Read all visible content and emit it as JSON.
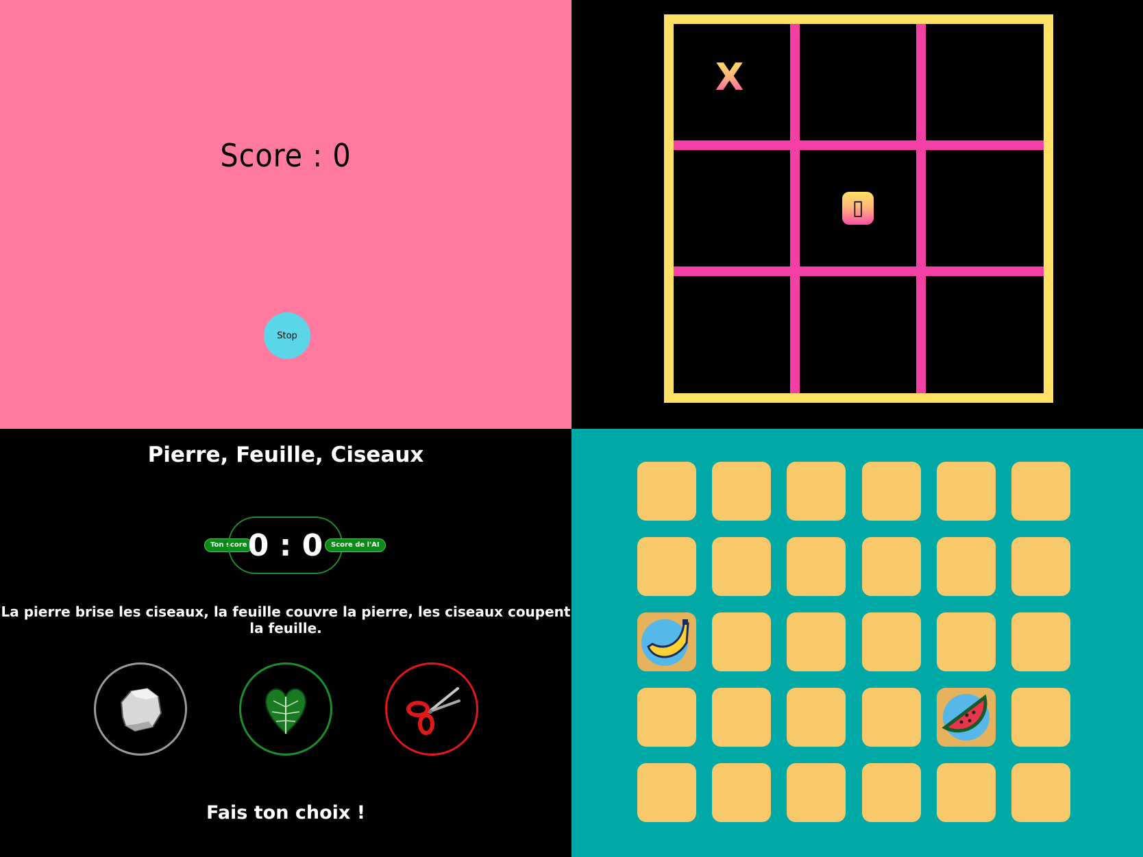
{
  "score_panel": {
    "score_text": "Score : 0",
    "stop_label": "Stop",
    "background": "#ff7a9e",
    "button_color": "#5bd5e8"
  },
  "tic_tac_toe": {
    "board": [
      "X",
      "",
      "",
      "",
      "O",
      "",
      "",
      "",
      ""
    ],
    "frame_color": "#ffe066",
    "grid_color": "#f43fa5"
  },
  "rps": {
    "title": "Pierre, Feuille, Ciseaux",
    "your_score_label": "Ton score",
    "ai_score_label": "Score de l'AI",
    "score_display": "0 : 0",
    "rules": "La pierre brise les ciseaux, la feuille couvre la pierre, les ciseaux coupent la feuille.",
    "prompt": "Fais ton choix !",
    "choices": [
      {
        "name": "rock",
        "icon": "rock-icon",
        "color": "#9a9a9a"
      },
      {
        "name": "paper",
        "icon": "leaf-icon",
        "color": "#1a8f2a"
      },
      {
        "name": "scissors",
        "icon": "scissors-icon",
        "color": "#e01818"
      }
    ]
  },
  "memory": {
    "background": "#00a9a5",
    "card_color": "#f8c96a",
    "rows": 5,
    "cols": 6,
    "revealed": [
      {
        "row": 2,
        "col": 0,
        "icon": "banana-icon"
      },
      {
        "row": 3,
        "col": 4,
        "icon": "watermelon-icon"
      }
    ]
  }
}
